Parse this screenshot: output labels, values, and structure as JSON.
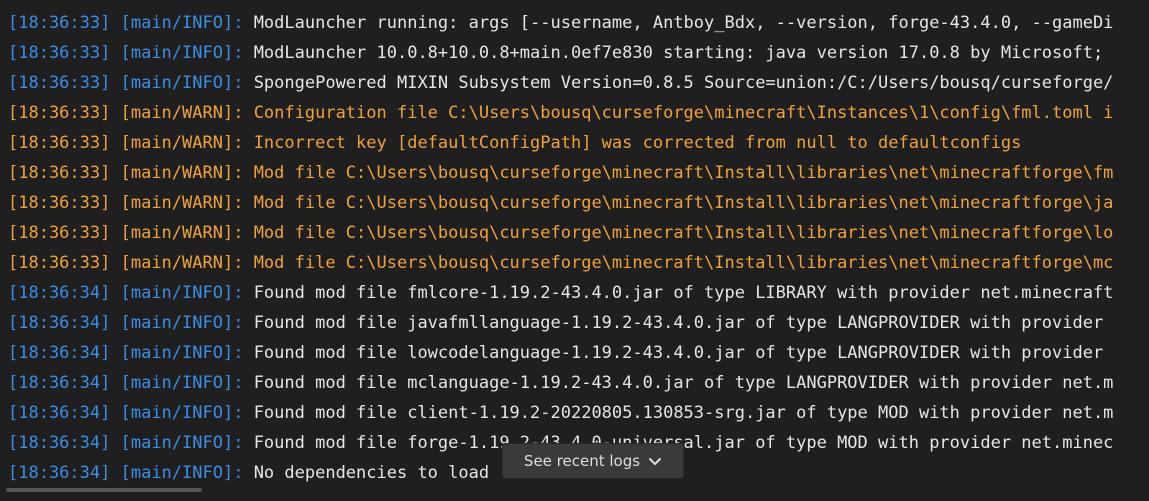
{
  "log": {
    "lines": [
      {
        "level": "info",
        "time": "[18:36:33]",
        "source": "[main/INFO]:",
        "message": "ModLauncher running: args [--username, Antboy_Bdx, --version, forge-43.4.0, --gameDi"
      },
      {
        "level": "info",
        "time": "[18:36:33]",
        "source": "[main/INFO]:",
        "message": "ModLauncher 10.0.8+10.0.8+main.0ef7e830 starting: java version 17.0.8 by Microsoft;"
      },
      {
        "level": "info",
        "time": "[18:36:33]",
        "source": "[main/INFO]:",
        "message": "SpongePowered MIXIN Subsystem Version=0.8.5 Source=union:/C:/Users/bousq/curseforge/"
      },
      {
        "level": "warn",
        "time": "[18:36:33]",
        "source": "[main/WARN]:",
        "message": "Configuration file C:\\Users\\bousq\\curseforge\\minecraft\\Instances\\1\\config\\fml.toml i"
      },
      {
        "level": "warn",
        "time": "[18:36:33]",
        "source": "[main/WARN]:",
        "message": "Incorrect key [defaultConfigPath] was corrected from null to defaultconfigs"
      },
      {
        "level": "warn",
        "time": "[18:36:33]",
        "source": "[main/WARN]:",
        "message": "Mod file C:\\Users\\bousq\\curseforge\\minecraft\\Install\\libraries\\net\\minecraftforge\\fm"
      },
      {
        "level": "warn",
        "time": "[18:36:33]",
        "source": "[main/WARN]:",
        "message": "Mod file C:\\Users\\bousq\\curseforge\\minecraft\\Install\\libraries\\net\\minecraftforge\\ja"
      },
      {
        "level": "warn",
        "time": "[18:36:33]",
        "source": "[main/WARN]:",
        "message": "Mod file C:\\Users\\bousq\\curseforge\\minecraft\\Install\\libraries\\net\\minecraftforge\\lo"
      },
      {
        "level": "warn",
        "time": "[18:36:33]",
        "source": "[main/WARN]:",
        "message": "Mod file C:\\Users\\bousq\\curseforge\\minecraft\\Install\\libraries\\net\\minecraftforge\\mc"
      },
      {
        "level": "info",
        "time": "[18:36:34]",
        "source": "[main/INFO]:",
        "message": "Found mod file fmlcore-1.19.2-43.4.0.jar of type LIBRARY with provider net.minecraft"
      },
      {
        "level": "info",
        "time": "[18:36:34]",
        "source": "[main/INFO]:",
        "message": "Found mod file javafmllanguage-1.19.2-43.4.0.jar of type LANGPROVIDER with provider"
      },
      {
        "level": "info",
        "time": "[18:36:34]",
        "source": "[main/INFO]:",
        "message": "Found mod file lowcodelanguage-1.19.2-43.4.0.jar of type LANGPROVIDER with provider"
      },
      {
        "level": "info",
        "time": "[18:36:34]",
        "source": "[main/INFO]:",
        "message": "Found mod file mclanguage-1.19.2-43.4.0.jar of type LANGPROVIDER with provider net.m"
      },
      {
        "level": "info",
        "time": "[18:36:34]",
        "source": "[main/INFO]:",
        "message": "Found mod file client-1.19.2-20220805.130853-srg.jar of type MOD with provider net.m"
      },
      {
        "level": "info",
        "time": "[18:36:34]",
        "source": "[main/INFO]:",
        "message": "Found mod file forge-1.19.2-43.4.0-universal.jar of type MOD with provider net.minec"
      },
      {
        "level": "info",
        "time": "[18:36:34]",
        "source": "[main/INFO]:",
        "message": "No dependencies to load"
      }
    ]
  },
  "recent_logs": {
    "label": "See recent logs",
    "icon": "chevron-down-icon"
  },
  "colors": {
    "background": "#1f1f1f",
    "info_meta": "#3a8ee6",
    "info_text": "#e6e6e6",
    "warn": "#f0a23a",
    "button_bg": "#3a3a3a"
  }
}
